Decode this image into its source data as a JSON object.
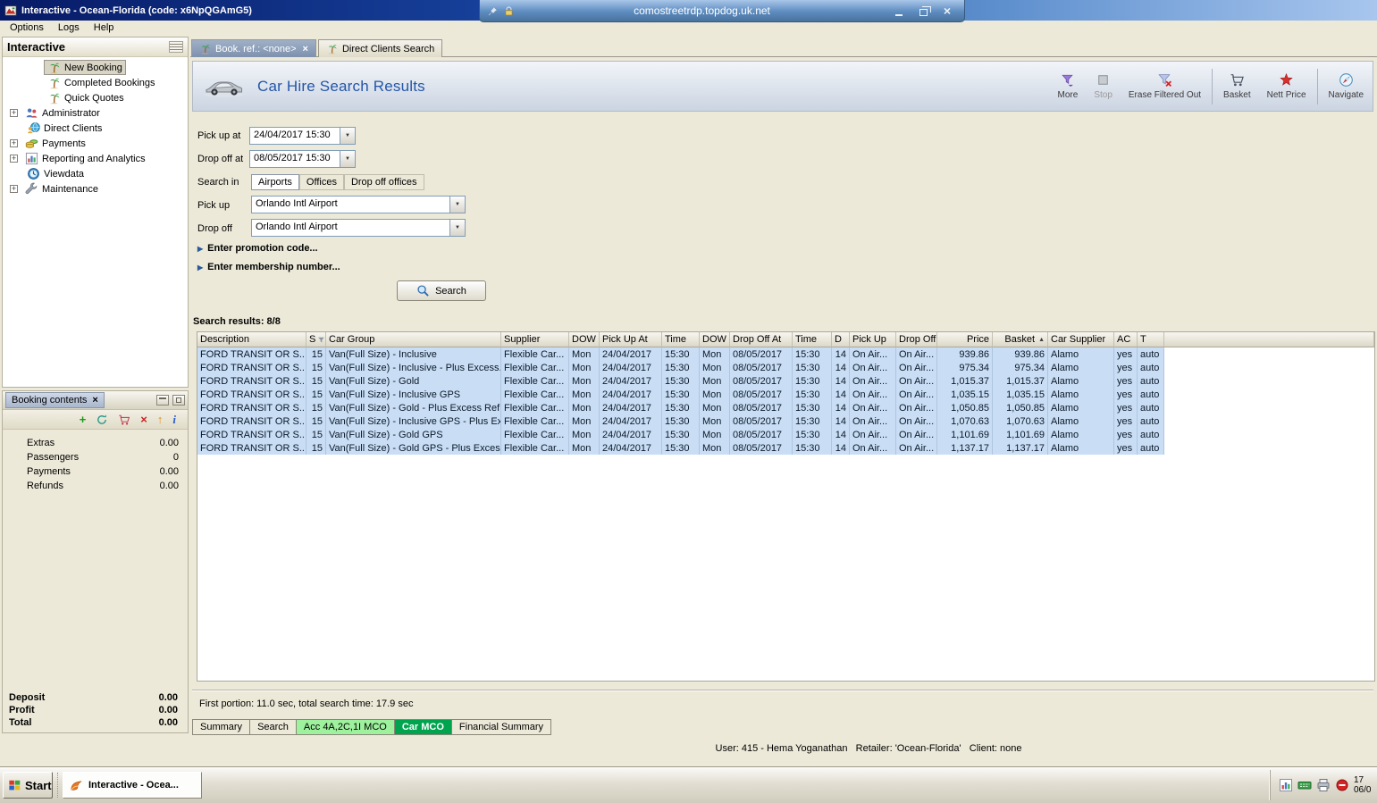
{
  "window_title": "Interactive - Ocean-Florida (code: x6NpQGAmG5)",
  "rdp_bar": {
    "address": "comostreetrdp.topdog.uk.net"
  },
  "menu_items": [
    "Options",
    "Logs",
    "Help"
  ],
  "sidebar": {
    "title": "Interactive",
    "items": [
      {
        "label": "New Booking",
        "icon": "palm-tree",
        "deep": true,
        "selected": true
      },
      {
        "label": "Completed Bookings",
        "icon": "palm-tree",
        "deep": true
      },
      {
        "label": "Quick Quotes",
        "icon": "palm-tree",
        "deep": true
      },
      {
        "label": "Administrator",
        "icon": "admin-users",
        "expandable": true
      },
      {
        "label": "Direct Clients",
        "icon": "direct-clients"
      },
      {
        "label": "Payments",
        "icon": "payments-coins",
        "expandable": true
      },
      {
        "label": "Reporting and Analytics",
        "icon": "reporting-chart",
        "expandable": true
      },
      {
        "label": "Viewdata",
        "icon": "viewdata-clock"
      },
      {
        "label": "Maintenance",
        "icon": "maintenance-wrench",
        "expandable": true
      }
    ]
  },
  "booking_contents": {
    "title": "Booking contents",
    "rows": [
      {
        "label": "Extras",
        "value": "0.00"
      },
      {
        "label": "Passengers",
        "value": "0"
      },
      {
        "label": "Payments",
        "value": "0.00"
      },
      {
        "label": "Refunds",
        "value": "0.00"
      }
    ],
    "totals": [
      {
        "label": "Deposit",
        "value": "0.00"
      },
      {
        "label": "Profit",
        "value": "0.00"
      },
      {
        "label": "Total",
        "value": "0.00"
      }
    ]
  },
  "doc_tabs": [
    {
      "label": "Book. ref.: <none>",
      "active": true,
      "closable": true
    },
    {
      "label": "Direct Clients Search"
    }
  ],
  "header": {
    "title": "Car Hire Search Results",
    "tools": [
      {
        "label": "More",
        "icon": "more-filter"
      },
      {
        "label": "Stop",
        "icon": "stop",
        "disabled": true
      },
      {
        "label": "Erase Filtered Out",
        "icon": "erase-filter"
      },
      {
        "sep": true
      },
      {
        "label": "Basket",
        "icon": "basket"
      },
      {
        "label": "Nett Price",
        "icon": "nett-price"
      },
      {
        "sep": true
      },
      {
        "label": "Navigate",
        "icon": "navigate"
      }
    ]
  },
  "form": {
    "pickup_at": {
      "label": "Pick up at",
      "value": "24/04/2017 15:30"
    },
    "dropoff_at": {
      "label": "Drop off at",
      "value": "08/05/2017 15:30"
    },
    "search_in": {
      "label": "Search in",
      "tabs": [
        "Airports",
        "Offices",
        "Drop off offices"
      ],
      "active": "Airports"
    },
    "pickup": {
      "label": "Pick up",
      "value": "Orlando Intl Airport"
    },
    "dropoff": {
      "label": "Drop off",
      "value": "Orlando Intl Airport"
    },
    "promo_link": "Enter promotion code...",
    "membership_link": "Enter membership number...",
    "search_button": "Search"
  },
  "results": {
    "summary": "Search results: 8/8",
    "columns": [
      "Description",
      "S",
      "Car Group",
      "Supplier",
      "DOW",
      "Pick Up At",
      "Time",
      "DOW",
      "Drop Off At",
      "Time",
      "D",
      "Pick Up",
      "Drop Off",
      "Price",
      "Basket",
      "Car Supplier",
      "AC",
      "T"
    ],
    "sort_column": "Basket",
    "rows": [
      [
        "FORD TRANSIT OR S...",
        "15",
        "Van(Full Size) - Inclusive",
        "Flexible Car...",
        "Mon",
        "24/04/2017",
        "15:30",
        "Mon",
        "08/05/2017",
        "15:30",
        "14",
        "On Air...",
        "On Air...",
        "939.86",
        "939.86",
        "Alamo",
        "yes",
        "auto"
      ],
      [
        "FORD TRANSIT OR S...",
        "15",
        "Van(Full Size) - Inclusive - Plus Excess...",
        "Flexible Car...",
        "Mon",
        "24/04/2017",
        "15:30",
        "Mon",
        "08/05/2017",
        "15:30",
        "14",
        "On Air...",
        "On Air...",
        "975.34",
        "975.34",
        "Alamo",
        "yes",
        "auto"
      ],
      [
        "FORD TRANSIT OR S...",
        "15",
        "Van(Full Size) - Gold",
        "Flexible Car...",
        "Mon",
        "24/04/2017",
        "15:30",
        "Mon",
        "08/05/2017",
        "15:30",
        "14",
        "On Air...",
        "On Air...",
        "1,015.37",
        "1,015.37",
        "Alamo",
        "yes",
        "auto"
      ],
      [
        "FORD TRANSIT OR S...",
        "15",
        "Van(Full Size) - Inclusive GPS",
        "Flexible Car...",
        "Mon",
        "24/04/2017",
        "15:30",
        "Mon",
        "08/05/2017",
        "15:30",
        "14",
        "On Air...",
        "On Air...",
        "1,035.15",
        "1,035.15",
        "Alamo",
        "yes",
        "auto"
      ],
      [
        "FORD TRANSIT OR S...",
        "15",
        "Van(Full Size) - Gold - Plus Excess Ref...",
        "Flexible Car...",
        "Mon",
        "24/04/2017",
        "15:30",
        "Mon",
        "08/05/2017",
        "15:30",
        "14",
        "On Air...",
        "On Air...",
        "1,050.85",
        "1,050.85",
        "Alamo",
        "yes",
        "auto"
      ],
      [
        "FORD TRANSIT OR S...",
        "15",
        "Van(Full Size) - Inclusive GPS - Plus Ex...",
        "Flexible Car...",
        "Mon",
        "24/04/2017",
        "15:30",
        "Mon",
        "08/05/2017",
        "15:30",
        "14",
        "On Air...",
        "On Air...",
        "1,070.63",
        "1,070.63",
        "Alamo",
        "yes",
        "auto"
      ],
      [
        "FORD TRANSIT OR S...",
        "15",
        "Van(Full Size) - Gold GPS",
        "Flexible Car...",
        "Mon",
        "24/04/2017",
        "15:30",
        "Mon",
        "08/05/2017",
        "15:30",
        "14",
        "On Air...",
        "On Air...",
        "1,101.69",
        "1,101.69",
        "Alamo",
        "yes",
        "auto"
      ],
      [
        "FORD TRANSIT OR S...",
        "15",
        "Van(Full Size) - Gold GPS - Plus Excess...",
        "Flexible Car...",
        "Mon",
        "24/04/2017",
        "15:30",
        "Mon",
        "08/05/2017",
        "15:30",
        "14",
        "On Air...",
        "On Air...",
        "1,137.17",
        "1,137.17",
        "Alamo",
        "yes",
        "auto"
      ]
    ]
  },
  "status_line": "First portion: 11.0 sec, total search time: 17.9 sec",
  "bottom_tabs": [
    {
      "label": "Summary",
      "style": "plain"
    },
    {
      "label": "Search",
      "style": "plain"
    },
    {
      "label": "Acc 4A,2C,1I MCO",
      "style": "green-light"
    },
    {
      "label": "Car MCO",
      "style": "green"
    },
    {
      "label": "Financial Summary",
      "style": "plain"
    }
  ],
  "footer_status": "User: 415 - Hema Yoganathan   Retailer: 'Ocean-Florida'   Client: none",
  "taskbar": {
    "start": "Start",
    "task_button": "Interactive - Ocea...",
    "clock_time": "17",
    "clock_date": "06/0"
  },
  "colors": {
    "selection_blue": "#c9def5",
    "tab_green": "#00a44e",
    "tab_green_light": "#9ef29e",
    "title_blue": "#2456a8"
  }
}
